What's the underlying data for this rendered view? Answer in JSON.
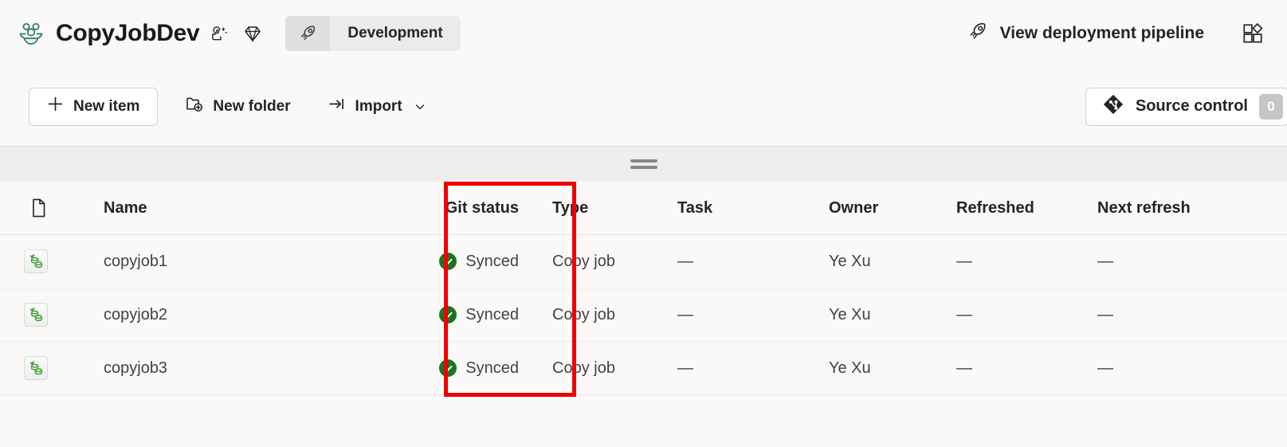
{
  "header": {
    "workspace_icon": "workspace-people-icon",
    "workspace_title": "CopyJobDev",
    "icons": [
      {
        "name": "sparkle-ai-icon"
      },
      {
        "name": "diamond-premium-icon"
      }
    ],
    "environment": {
      "icon": "rocket-icon",
      "label": "Development"
    },
    "deployment_pipeline": {
      "icon": "rocket-icon",
      "label": "View deployment pipeline"
    },
    "apps_icon": "apps-grid-add-icon"
  },
  "toolbar": {
    "new_item_label": "New item",
    "new_item_icon": "plus-icon",
    "new_folder_label": "New folder",
    "new_folder_icon": "folder-add-icon",
    "import_label": "Import",
    "import_icon": "import-arrow-icon",
    "import_chevron": "chevron-down-icon",
    "source_control_label": "Source control",
    "source_control_icon": "git-branch-icon",
    "source_control_count": "0"
  },
  "strip": {
    "drag_handle": "drag-handle"
  },
  "table": {
    "columns": [
      {
        "key": "icon",
        "label": ""
      },
      {
        "key": "name",
        "label": "Name"
      },
      {
        "key": "git_status",
        "label": "Git status"
      },
      {
        "key": "type",
        "label": "Type"
      },
      {
        "key": "task",
        "label": "Task"
      },
      {
        "key": "owner",
        "label": "Owner"
      },
      {
        "key": "refreshed",
        "label": "Refreshed"
      },
      {
        "key": "next_refresh",
        "label": "Next refresh"
      }
    ],
    "header_icon": "document-icon",
    "rows": [
      {
        "icon": "copy-job-icon",
        "name": "copyjob1",
        "git_status": "Synced",
        "git_status_icon": "checkmark-circle-icon",
        "type": "Copy job",
        "task": "—",
        "owner": "Ye Xu",
        "refreshed": "—",
        "next_refresh": "—"
      },
      {
        "icon": "copy-job-icon",
        "name": "copyjob2",
        "git_status": "Synced",
        "git_status_icon": "checkmark-circle-icon",
        "type": "Copy job",
        "task": "—",
        "owner": "Ye Xu",
        "refreshed": "—",
        "next_refresh": "—"
      },
      {
        "icon": "copy-job-icon",
        "name": "copyjob3",
        "git_status": "Synced",
        "git_status_icon": "checkmark-circle-icon",
        "type": "Copy job",
        "task": "—",
        "owner": "Ye Xu",
        "refreshed": "—",
        "next_refresh": "—"
      }
    ]
  },
  "annotation": {
    "highlight_color": "#ee0000",
    "target_column": "Git status"
  },
  "colors": {
    "background": "#faf9f8",
    "synced_green": "#1d7324",
    "workspace_icon_teal": "#2f7d6e",
    "copyjob_green": "#4a9c3d",
    "badge_gray": "#c8c6c4"
  }
}
